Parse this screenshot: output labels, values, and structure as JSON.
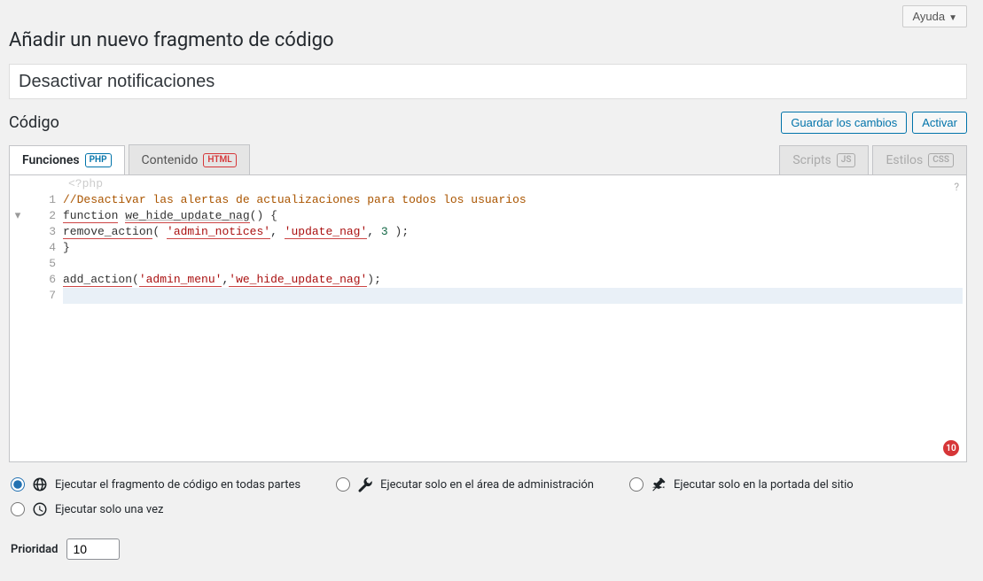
{
  "help_label": "Ayuda",
  "page_title": "Añadir un nuevo fragmento de código",
  "snippet_title": "Desactivar notificaciones",
  "section_title": "Código",
  "save_label": "Guardar los cambios",
  "activate_label": "Activar",
  "tabs": {
    "functions": "Funciones",
    "content": "Contenido",
    "scripts": "Scripts",
    "styles": "Estilos",
    "php": "PHP",
    "html": "HTML",
    "js": "JS",
    "css": "CSS"
  },
  "editor": {
    "leader": "<?php",
    "help": "?",
    "error_count": "10",
    "lines": {
      "n1": "1",
      "n2": "2",
      "n3": "3",
      "n4": "4",
      "n5": "5",
      "n6": "6",
      "n7": "7",
      "fold": "▾",
      "l1_comment": "//Desactivar las alertas de actualizaciones para todos los usuarios",
      "l2_kw": "function",
      "l2_name": "we_hide_update_nag",
      "l2_rest": "() {",
      "l3_fn": "remove_action",
      "l3_a": "( ",
      "l3_s1": "'admin_notices'",
      "l3_c1": ", ",
      "l3_s2": "'update_nag'",
      "l3_c2": ", ",
      "l3_num": "3",
      "l3_end": " );",
      "l4": "}",
      "l6_fn": "add_action",
      "l6_a": "(",
      "l6_s1": "'admin_menu'",
      "l6_c1": ",",
      "l6_s2": "'we_hide_update_nag'",
      "l6_end": ");"
    }
  },
  "scope": {
    "everywhere": "Ejecutar el fragmento de código en todas partes",
    "admin": "Ejecutar solo en el área de administración",
    "front": "Ejecutar solo en la portada del sitio",
    "once": "Ejecutar solo una vez"
  },
  "priority_label": "Prioridad",
  "priority_value": "10"
}
